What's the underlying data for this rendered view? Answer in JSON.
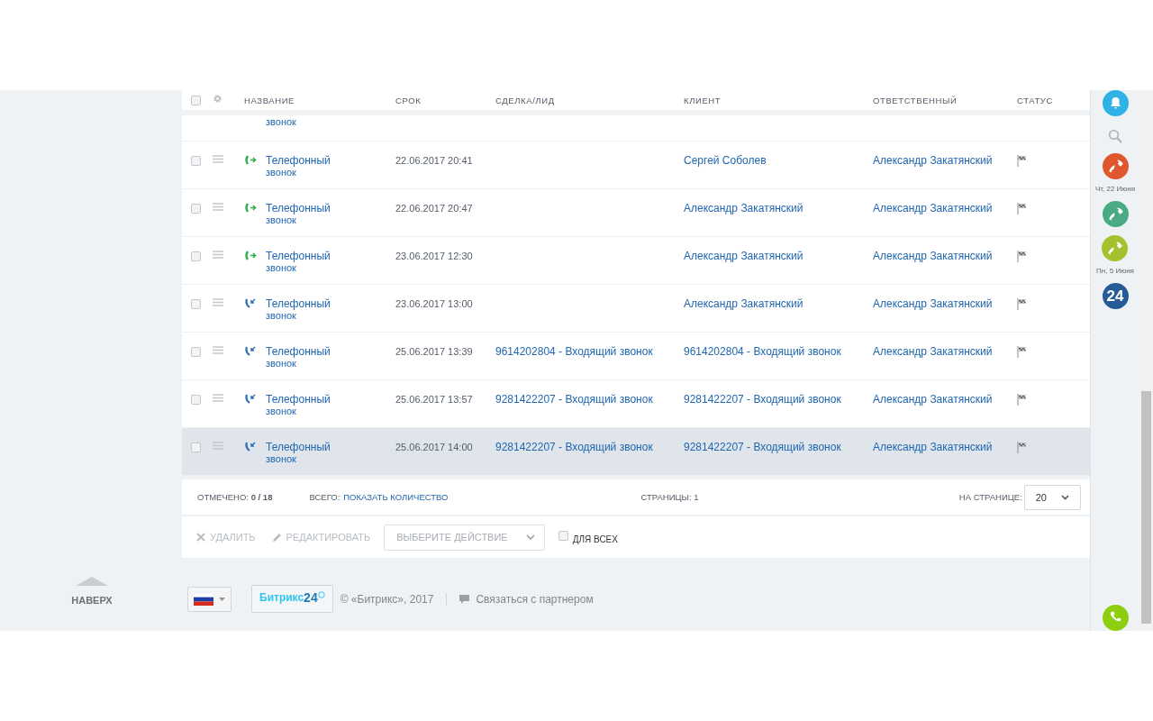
{
  "table": {
    "select_all": {
      "checked": false
    },
    "columns": [
      "НАЗВАНИЕ",
      "СРОК",
      "СДЕЛКА/ЛИД",
      "КЛИЕНТ",
      "ОТВЕТСТВЕННЫЙ",
      "СТАТУС"
    ],
    "partial_row": {
      "name_tail": "звонок"
    },
    "rows": [
      {
        "kind": "outgoing",
        "checked": false,
        "highlighted": false,
        "name": "Телефонный",
        "name_tail": "звонок",
        "date": "22.06.2017 20:41",
        "deal": "",
        "client": "Сергей Соболев",
        "responsible": "Александр Закатянский"
      },
      {
        "kind": "outgoing",
        "checked": false,
        "highlighted": false,
        "name": "Телефонный",
        "name_tail": "звонок",
        "date": "22.06.2017 20:47",
        "deal": "",
        "client": "Александр Закатянский",
        "responsible": "Александр Закатянский"
      },
      {
        "kind": "outgoing",
        "checked": false,
        "highlighted": false,
        "name": "Телефонный",
        "name_tail": "звонок",
        "date": "23.06.2017 12:30",
        "deal": "",
        "client": "Александр Закатянский",
        "responsible": "Александр Закатянский"
      },
      {
        "kind": "incoming",
        "checked": false,
        "highlighted": false,
        "name": "Телефонный",
        "name_tail": "звонок",
        "date": "23.06.2017 13:00",
        "deal": "",
        "client": "Александр Закатянский",
        "responsible": "Александр Закатянский"
      },
      {
        "kind": "incoming",
        "checked": false,
        "highlighted": false,
        "name": "Телефонный",
        "name_tail": "звонок",
        "date": "25.06.2017 13:39",
        "deal": "9614202804 - Входящий звонок",
        "client": "9614202804 - Входящий звонок",
        "responsible": "Александр Закатянский"
      },
      {
        "kind": "incoming",
        "checked": false,
        "highlighted": false,
        "name": "Телефонный",
        "name_tail": "звонок",
        "date": "25.06.2017 13:57",
        "deal": "9281422207 - Входящий звонок",
        "client": "9281422207 - Входящий звонок",
        "responsible": "Александр Закатянский"
      },
      {
        "kind": "incoming",
        "checked": false,
        "highlighted": true,
        "name": "Телефонный",
        "name_tail": "звонок",
        "date": "25.06.2017 14:00",
        "deal": "9281422207 - Входящий звонок",
        "client": "9281422207 - Входящий звонок",
        "responsible": "Александр Закатянский"
      }
    ]
  },
  "summary": {
    "checked": "ОТМЕЧЕНО: **0 / 18**",
    "total_label": "ВСЕГО:",
    "total_link": "ПОКАЗАТЬ КОЛИЧЕСТВО",
    "pages": "СТРАНИЦЫ: 1",
    "per_page_label": "НА СТРАНИЦЕ:",
    "per_page": "20"
  },
  "actions": {
    "delete": {
      "label": "УДАЛИТЬ",
      "disabled": true
    },
    "edit": {
      "label": "РЕДАКТИРОВАТЬ",
      "disabled": true
    },
    "select": {
      "placeholder": "ВЫБЕРИТЕ ДЕЙСТВИЕ"
    },
    "for_all": {
      "label": "ДЛЯ ВСЕХ",
      "checked": false
    }
  },
  "to_top": "НАВЕРХ",
  "footer": {
    "logo_name": "Битрикс",
    "logo_number": "24",
    "copyright": "© «Битрикс», 2017",
    "partner_link": "Связаться с партнером"
  },
  "right_panel": {
    "items": [
      {
        "kind": "bell",
        "color": "#2fb3e6"
      },
      {
        "kind": "search"
      },
      {
        "kind": "call",
        "color": "#e0562e",
        "date": "Чт, 22 Июня"
      },
      {
        "kind": "call",
        "color": "#4aaa85"
      },
      {
        "kind": "call",
        "color": "#a5c12d",
        "date": "Пн, 5 Июня"
      },
      {
        "kind": "logo",
        "color": "#255c97",
        "text": "24"
      }
    ],
    "call_button": {
      "color": "#8dcf0e"
    }
  }
}
